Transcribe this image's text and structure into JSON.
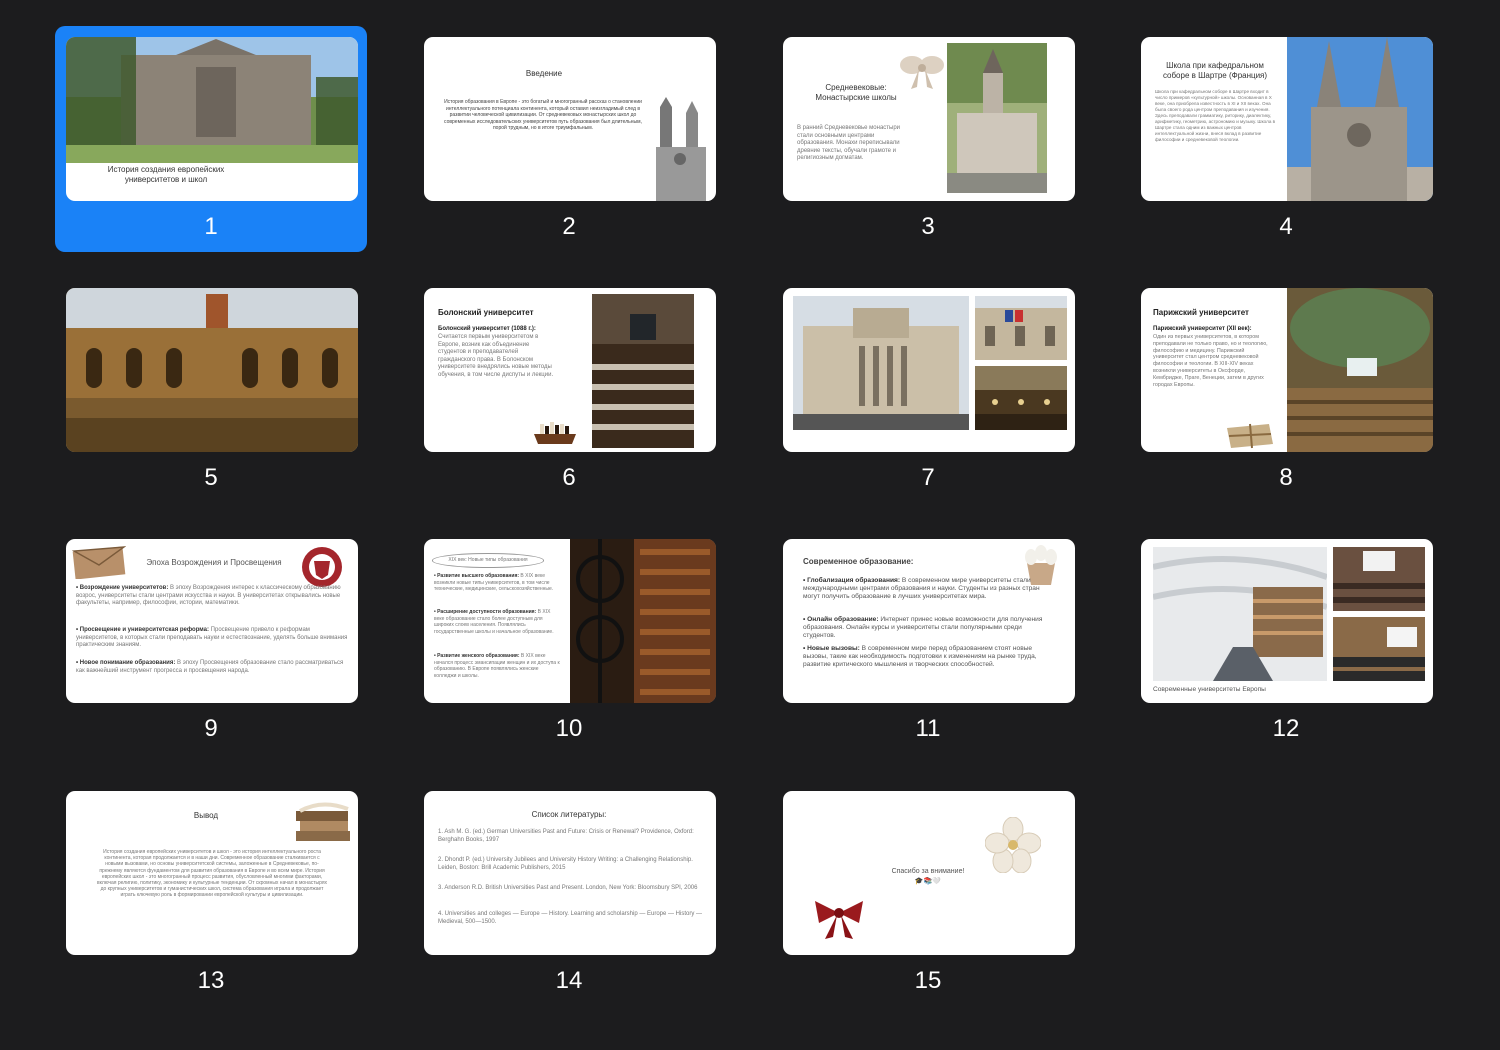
{
  "slides": [
    {
      "number": "1",
      "title": "История создания европейских университетов и школ"
    },
    {
      "number": "2",
      "title": "Введение",
      "body": "История образования в Европе - это богатый и многогранный рассказ о становлении интеллектуального потенциала континента, который оставил неизгладимый след в развитии человеческой цивилизации. От средневековых монастырских школ до современных исследовательских университетов путь образования был длительным, порой трудным, но в итоге триумфальным."
    },
    {
      "number": "3",
      "title": "Средневековые: Монастырские школы",
      "body": "В ранний Средневековье монастыри стали основными центрами образования. Монахи переписывали древние тексты, обучали грамоте и религиозным догматам."
    },
    {
      "number": "4",
      "title": "Школа при кафедральном соборе в Шартре (Франция)",
      "body": "Школа при кафедральном соборе в Шартре входит в число примеров «культурной» школы. Основанная в X веке, она приобрела известность в XI и XII веках. Она была своего рода центром преподавания и изучения. Здесь преподавали грамматику, риторику, диалектику, арифметику, геометрию, астрономию и музыку. Школа в Шартре стала одним из важных центров интеллектуальной жизни, внеся вклад в развитие философии и средневековой теологии."
    },
    {
      "number": "5"
    },
    {
      "number": "6",
      "title": "Болонский университет",
      "body_bold": "Болонский университет (1088 г.):",
      "body": "Считается первым университетом в Европе, возник как объединение студентов и преподавателей гражданского права. В Болонском университете внедрялись новые методы обучения, в том числе диспуты и лекции."
    },
    {
      "number": "7"
    },
    {
      "number": "8",
      "title": "Парижский университет",
      "body_bold": "Парижский университет (XII век):",
      "body": "Один из первых университетов, в котором преподавали не только право, но и теологию, философию и медицину. Парижский университет стал центром средневековой философии и теологии. В XIII-XIV веках возникли университеты в Оксфорде, Кембридже, Праге, Венеции, затем в других городах Европы."
    },
    {
      "number": "9",
      "title": "Эпоха Возрождения и Просвещения",
      "items": [
        {
          "bold": "• Возрождение университетов:",
          "text": "В эпоху Возрождения интерес к классическому образованию возрос, университеты стали центрами искусства и науки. В университетах открывались новые факультеты, например, философии, истории, математики."
        },
        {
          "bold": "• Просвещение и университетская реформа:",
          "text": "Просвещение привело к реформам университетов, в которых стали преподавать науки и естествознание, уделять больше внимания практическим знаниям."
        },
        {
          "bold": "• Новое понимание образования:",
          "text": "В эпоху Просвещения образование стало рассматриваться как важнейший инструмент прогресса и просвещения народа."
        }
      ]
    },
    {
      "number": "10",
      "title": "XIX век: Новые типы образования",
      "items": [
        {
          "bold": "• Развитие высшего образования:",
          "text": "В XIX веке возникли новые типы университетов, в том числе технические, медицинские, сельскохозяйственные."
        },
        {
          "bold": "• Расширение доступности образования:",
          "text": "В XIX веке образование стало более доступным для широких слоев населения. Появлялись государственные школы и начальное образование."
        },
        {
          "bold": "• Развитие женского образования:",
          "text": "В XIX веке начался процесс эмансипации женщин и их доступа к образованию. В Европе появлялись женские колледжи и школы."
        }
      ]
    },
    {
      "number": "11",
      "title": "Современное образование:",
      "items": [
        {
          "bold": "• Глобализация образования:",
          "text": "В современном мире университеты стали международными центрами образования и науки. Студенты из разных стран могут получить образование в лучших университетах мира."
        },
        {
          "bold": "• Онлайн образование:",
          "text": "Интернет принес новые возможности для получения образования. Онлайн курсы и университеты стали популярными среди студентов."
        },
        {
          "bold": "• Новые вызовы:",
          "text": "В современном мире перед образованием стоят новые вызовы, такие как необходимость подготовки к изменениям на рынке труда, развитие критического мышления и творческих способностей."
        }
      ]
    },
    {
      "number": "12",
      "caption": "Современные университеты Европы"
    },
    {
      "number": "13",
      "title": "Вывод",
      "body": "История создания европейских университетов и школ - это история интеллектуального роста континента, которая продолжается и в наши дни. Современное образование сталкивается с новыми вызовами, но основы университетской системы, заложенные в Средневековье, по-прежнему являются фундаментом для развития образования в Европе и во всем мире. История европейских школ - это многогранный процесс развития, обусловленный многими факторами, включая религию, политику, экономику и культурные тенденции. От скромных начал в монастырях до крупных университетов и гуманистических школ, система образования играла и продолжает играть ключевую роль в формировании европейской культуры и цивилизации."
    },
    {
      "number": "14",
      "title": "Список литературы:",
      "refs": [
        "1.   Ash M. G. (ed.) German Universities Past and Future: Crisis or Renewal? Providence, Oxford: Berghahn Books, 1997",
        "2.   Dhondt P. (ed.) University Jubilees and University History Writing: a Challenging Relationship. Leiden, Boston: Brill Academic Publishers, 2015",
        "3.   Anderson R.D. British Universities Past and Present. London, New York: Bloomsbury SPI, 2006",
        "4.   Universities and colleges — Europe — History. Learning and scholarship — Europe — History — Medieval, 500—1500."
      ]
    },
    {
      "number": "15",
      "title": "Спасибо за внимание!",
      "emoji": "🎓📚🤍"
    }
  ]
}
